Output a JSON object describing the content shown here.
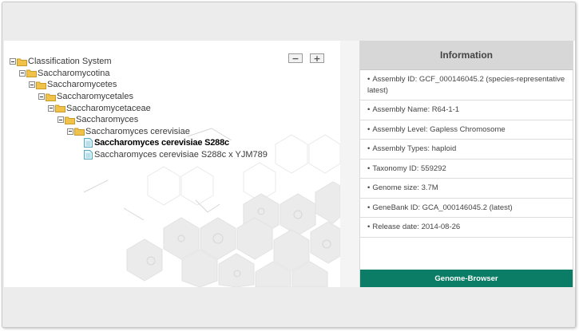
{
  "tree": {
    "collapse_label": "−",
    "expand_label": "+",
    "nodes": [
      {
        "label": "Classification System"
      },
      {
        "label": "Saccharomycotina"
      },
      {
        "label": "Saccharomycetes"
      },
      {
        "label": "Saccharomycetales"
      },
      {
        "label": "Saccharomycetaceae"
      },
      {
        "label": "Saccharomyces"
      },
      {
        "label": "Saccharomyces cerevisiae"
      },
      {
        "label": "Saccharomyces cerevisiae S288c"
      },
      {
        "label": "Saccharomyces cerevisiae S288c x YJM789"
      }
    ]
  },
  "info": {
    "title": "Information",
    "items": [
      {
        "text": "Assembly ID: GCF_000146045.2 (species-representative latest)"
      },
      {
        "text": "Assembly Name: R64-1-1"
      },
      {
        "text": "Assembly Level: Gapless Chromosome"
      },
      {
        "text": "Assembly Types: haploid"
      },
      {
        "text": "Taxonomy ID: 559292"
      },
      {
        "text": "Genome size: 3.7M"
      },
      {
        "text": "GeneBank ID: GCA_000146045.2 (latest)"
      },
      {
        "text": "Release date: 2014-08-26"
      }
    ],
    "button_label": "Genome-Browser"
  },
  "colors": {
    "button_bg": "#0b7d66",
    "header_bg": "#d7d7d7",
    "folder": "#f0c24a"
  },
  "icons": [
    "collapse-icon",
    "folder-icon",
    "document-icon"
  ]
}
